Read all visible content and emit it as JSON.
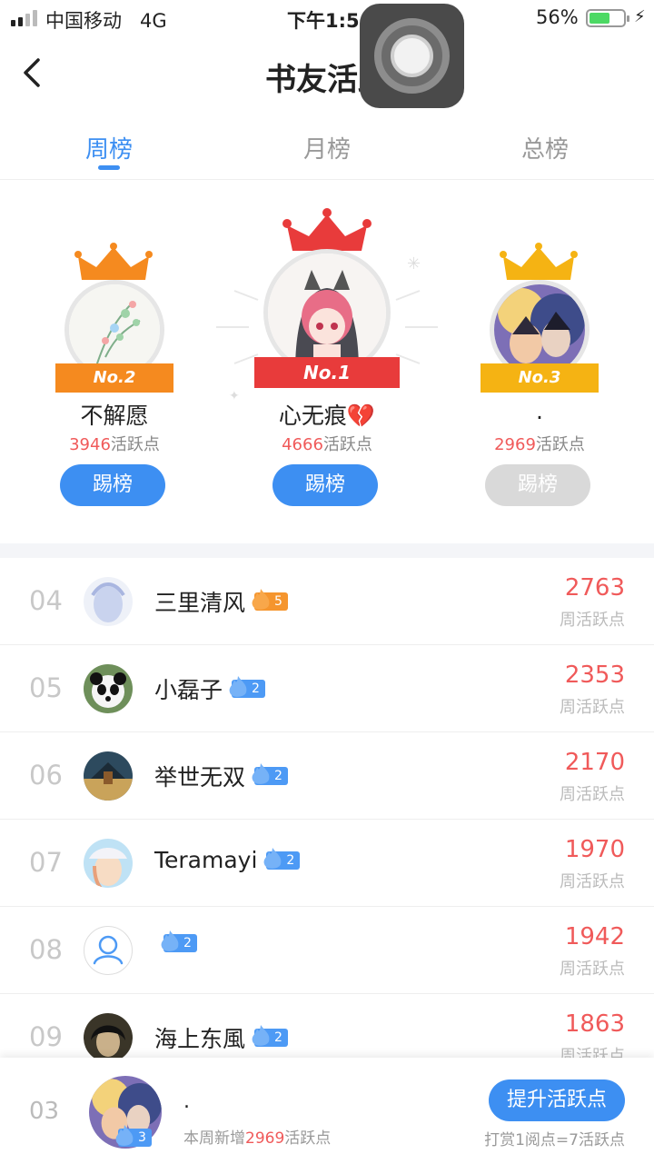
{
  "status_bar": {
    "carrier": "中国移动",
    "network": "4G",
    "time": "下午1:5",
    "battery": "56%"
  },
  "header": {
    "title": "书友活跃"
  },
  "tabs": [
    "周榜",
    "月榜",
    "总榜"
  ],
  "active_tab": "周榜",
  "podium": [
    {
      "rank_label": "No.2",
      "name": "不解愿",
      "points": "3946",
      "points_unit": "活跃点",
      "button": "踢榜",
      "button_enabled": true
    },
    {
      "rank_label": "No.1",
      "name": "心无痕💔",
      "points": "4666",
      "points_unit": "活跃点",
      "button": "踢榜",
      "button_enabled": true
    },
    {
      "rank_label": "No.3",
      "name": ".",
      "points": "2969",
      "points_unit": "活跃点",
      "button": "踢榜",
      "button_enabled": false
    }
  ],
  "list": [
    {
      "rank": "04",
      "name": "三里清风",
      "level": "5",
      "level_color": "orange",
      "value": "2763",
      "unit": "周活跃点"
    },
    {
      "rank": "05",
      "name": "小磊子",
      "level": "2",
      "level_color": "blue",
      "value": "2353",
      "unit": "周活跃点"
    },
    {
      "rank": "06",
      "name": " 举世无双",
      "level": "2",
      "level_color": "blue",
      "value": "2170",
      "unit": "周活跃点"
    },
    {
      "rank": "07",
      "name": "Teramayi",
      "level": "2",
      "level_color": "blue",
      "value": "1970",
      "unit": "周活跃点"
    },
    {
      "rank": "08",
      "name": "",
      "level": "2",
      "level_color": "blue",
      "value": "1942",
      "unit": "周活跃点"
    },
    {
      "rank": "09",
      "name": "海上东風",
      "level": "2",
      "level_color": "blue",
      "value": "1863",
      "unit": "周活跃点"
    }
  ],
  "mine": {
    "rank": "03",
    "name": ".",
    "level": "3",
    "sub_prefix": "本周新增",
    "sub_value": "2969",
    "sub_suffix": "活跃点",
    "button": "提升活跃点",
    "hint": "打赏1阅点=7活跃点"
  },
  "colors": {
    "accent": "#3d8ff2",
    "points": "#f05a5a",
    "first": "#e83b3b",
    "second": "#f58a1f",
    "third": "#f5b313"
  }
}
